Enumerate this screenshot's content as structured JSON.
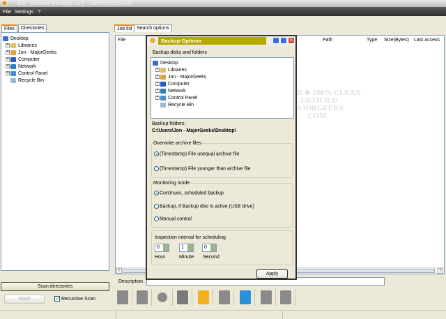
{
  "window": {
    "title": "Jon - Backup Manager v2.0 - DEMOVERSION"
  },
  "menu": [
    "File",
    "Settings",
    "?"
  ],
  "left": {
    "tabs": [
      "Files",
      "Directories"
    ],
    "tree": [
      {
        "label": "Desktop",
        "expand": false,
        "color": "#3a6fc9"
      },
      {
        "label": "Libraries",
        "expand": true,
        "color": "#e0c060"
      },
      {
        "label": "Jon - MajorGeeks",
        "expand": true,
        "color": "#d9a441"
      },
      {
        "label": "Computer",
        "expand": true,
        "color": "#2a5bbf"
      },
      {
        "label": "Network",
        "expand": true,
        "color": "#2a7fbf"
      },
      {
        "label": "Control Panel",
        "expand": true,
        "color": "#4a8fd0"
      },
      {
        "label": "Recycle Bin",
        "expand": false,
        "color": "#9bb8d8"
      }
    ],
    "scan_button": "Scan directories",
    "abort_button": "Abort",
    "recursive_label": "Recursive Scan",
    "recursive_checked": true
  },
  "right": {
    "tabs": [
      "Job list",
      "Search options"
    ],
    "columns": [
      "File",
      "Path",
      "Type",
      "Size(Bytes)",
      "Last access"
    ],
    "description_label": "Description",
    "description_value": ""
  },
  "toolbar": [
    "stop-icon",
    "log-icon",
    "delete-icon",
    "stamp-icon",
    "upload-layers-icon",
    "download-icon",
    "upload-icon",
    "folder-icon",
    "key-icon"
  ],
  "dialog": {
    "title": "Backup-Optiona",
    "section_label": "Backup disks and folders",
    "tree": [
      "Desktop",
      "Libraries",
      "Jon - MajorGeeks",
      "Computer",
      "Network",
      "Control Panel",
      "Recycle Bin"
    ],
    "backup_folders_label": "Backup folders:",
    "backup_folder_path": "C:\\Users\\Jon - MajorGeeks\\Desktop\\",
    "overwrite": {
      "legend": "Overwrite archive files",
      "options": [
        "(Timestamp) File unequal archive file",
        "(Timestamp) File younger than archive file"
      ],
      "selected": 0
    },
    "monitoring": {
      "legend": "Monitoring mode",
      "options": [
        "Continues, scheduled backup",
        "Backup, if Backup disc is active (USB drive)",
        "Manual control"
      ],
      "selected": 0
    },
    "interval": {
      "label": "Inspection interval for scheduling",
      "hour": "0",
      "minute": "1",
      "second": "0",
      "hour_label": "Hour",
      "minute_label": "Minute",
      "second_label": "Second"
    },
    "apply_button": "Apply"
  },
  "watermark": {
    "line1": "TESTED * 100% CLEAN",
    "line2": "CERTIFIED",
    "line3": "MAJORGEEKS",
    "line4": ".COM"
  }
}
